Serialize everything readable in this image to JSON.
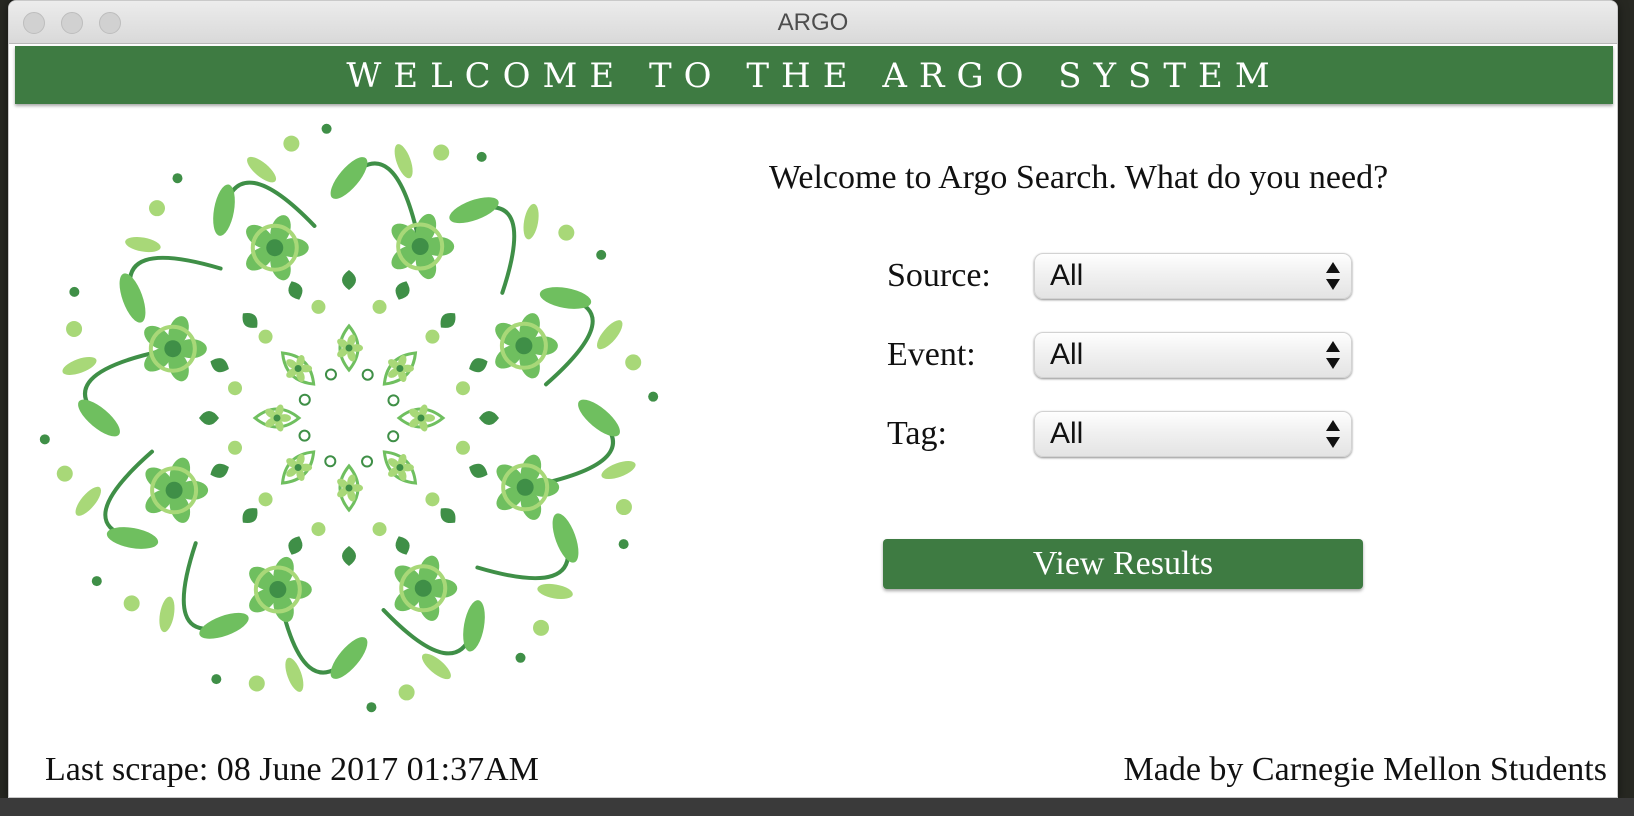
{
  "window": {
    "title": "ARGO"
  },
  "banner": {
    "title": "WELCOME TO THE ARGO SYSTEM"
  },
  "search": {
    "prompt": "Welcome to Argo Search. What do you need?",
    "fields": [
      {
        "label": "Source:",
        "value": "All"
      },
      {
        "label": "Event:",
        "value": "All"
      },
      {
        "label": "Tag:",
        "value": "All"
      }
    ],
    "submit_label": "View Results"
  },
  "footer": {
    "last_scrape": "Last scrape: 08 June 2017 01:37AM",
    "credit": "Made by Carnegie Mellon Students"
  },
  "colors": {
    "brand_green": "#3e7b42",
    "mandala_dark": "#3f8f47",
    "mandala_mid": "#6fbf5f",
    "mandala_light": "#a8d878"
  },
  "icons": {
    "select_arrows": "up-down-arrows-icon",
    "mandala": "floral-mandala-illustration"
  }
}
